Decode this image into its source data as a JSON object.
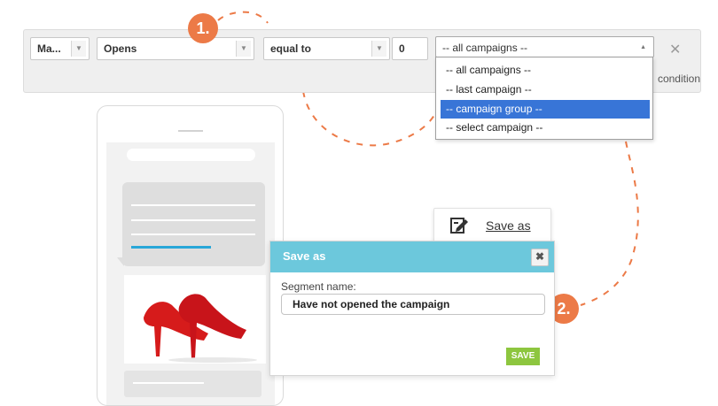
{
  "condition_bar": {
    "match_select": "Ma...",
    "metric_select": "Opens",
    "operator_select": "equal to",
    "count_value": "0",
    "campaign_select": "-- all campaigns --",
    "remove_icon": "close-icon",
    "partial_label": "condition"
  },
  "campaign_dropdown": {
    "options": [
      {
        "label": "-- all campaigns --",
        "selected": false
      },
      {
        "label": "-- last campaign --",
        "selected": false
      },
      {
        "label": "-- campaign group --",
        "selected": true
      },
      {
        "label": "-- select campaign --",
        "selected": false
      }
    ],
    "highlight_color": "#3875d7"
  },
  "steps": [
    {
      "label": "1."
    },
    {
      "label": "2."
    }
  ],
  "save_as_button": {
    "label": "Save as",
    "icon": "edit-note-icon"
  },
  "save_dialog": {
    "title": "Save as",
    "segment_label": "Segment name:",
    "segment_value": "Have not opened the campaign",
    "save_label": "SAVE"
  },
  "colors": {
    "accent_orange": "#ec7a47",
    "dialog_header": "#6cc8dc",
    "save_green": "#8dc63f",
    "shoe_red": "#d61b1b"
  }
}
